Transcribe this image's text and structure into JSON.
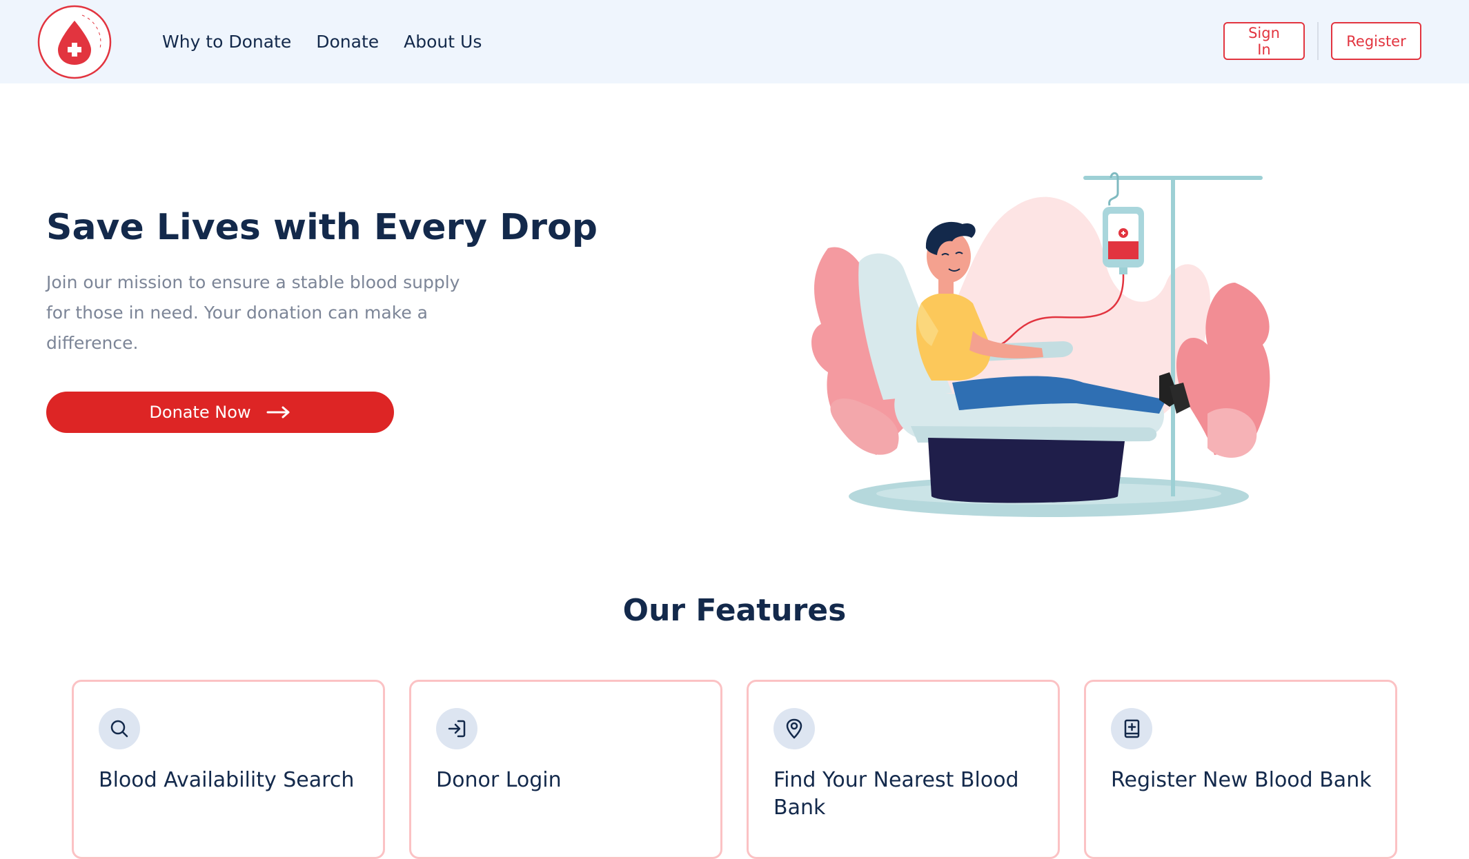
{
  "colors": {
    "primary_red": "#dd2525",
    "outline_red": "#e2343f",
    "navy": "#13294b",
    "muted_text": "#7c8597",
    "nav_background": "#eff5fd",
    "card_border": "#fbc2c4",
    "icon_circle": "#dde5f1"
  },
  "header": {
    "logo_icon": "blood-drop-plus-icon",
    "logo_ring_text": "Life • BLOOD • BANK",
    "nav": [
      {
        "label": "Why to Donate"
      },
      {
        "label": "Donate"
      },
      {
        "label": "About Us"
      }
    ],
    "sign_in_label": "Sign In",
    "register_label": "Register"
  },
  "hero": {
    "title": "Save Lives with Every Drop",
    "subtitle": "Join our mission to ensure a stable blood supply for those in need. Your donation can make a difference.",
    "cta_label": "Donate Now",
    "cta_icon": "arrow-right-icon",
    "illustration": "man-donating-blood-illustration"
  },
  "features": {
    "title": "Our Features",
    "items": [
      {
        "icon": "search-icon",
        "label": "Blood Availability Search"
      },
      {
        "icon": "login-icon",
        "label": "Donor Login"
      },
      {
        "icon": "map-pin-icon",
        "label": "Find Your Nearest Blood Bank"
      },
      {
        "icon": "add-book-icon",
        "label": "Register New Blood Bank"
      }
    ]
  }
}
